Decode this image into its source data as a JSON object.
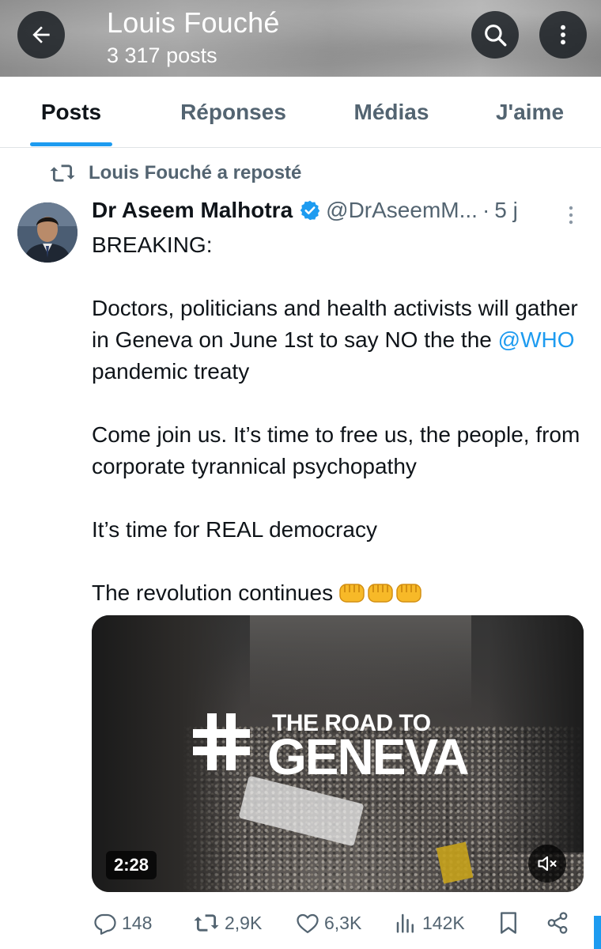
{
  "header": {
    "title": "Louis Fouché",
    "subtitle": "3 317 posts",
    "back_icon": "arrow-left-icon",
    "search_icon": "search-icon",
    "more_icon": "more-vertical-icon"
  },
  "tabs": [
    {
      "label": "Posts",
      "active": true
    },
    {
      "label": "Réponses",
      "active": false
    },
    {
      "label": "Médias",
      "active": false
    },
    {
      "label": "J'aime",
      "active": false
    }
  ],
  "repost": {
    "icon": "repost-icon",
    "text": "Louis Fouché a reposté"
  },
  "post": {
    "author": "Dr Aseem Malhotra",
    "verified": true,
    "handle": "@DrAseemM...",
    "dot": "·",
    "time": "5 j",
    "lines": {
      "l1": "BREAKING:",
      "l2a": "Doctors, politicians and health activists will gather in Geneva on June 1st to say NO the the ",
      "l2_mention": "@WHO",
      "l2b": " pandemic treaty",
      "l3": "Come join us. It’s time to free us, the people, from corporate tyrannical psychopathy",
      "l4": "It’s time for REAL democracy",
      "l5": "The revolution continues"
    },
    "media": {
      "logo_line1": "THE ROAD TO",
      "logo_line2": "GENEVA",
      "duration": "2:28",
      "mute_icon": "speaker-muted-icon"
    },
    "actions": {
      "replies": "148",
      "reposts": "2,9K",
      "likes": "6,3K",
      "views": "142K"
    }
  },
  "colors": {
    "accent": "#1d9bf0",
    "text_primary": "#0f1419",
    "text_secondary": "#536471",
    "verified": "#1d9bf0"
  }
}
